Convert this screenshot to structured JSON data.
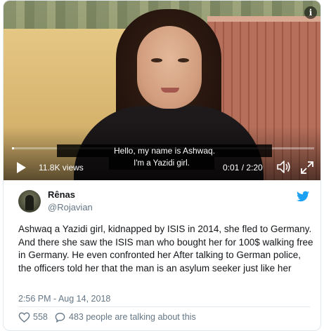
{
  "video": {
    "subtitle_line1": "Hello, my name is Ashwaq.",
    "subtitle_line2": "I'm a Yazidi girl.",
    "views": "11.8K views",
    "time": "0:01 / 2:20",
    "progress": 0.007,
    "icons": {
      "info": "info-icon",
      "play": "play-icon",
      "volume": "volume-icon",
      "fullscreen": "fullscreen-icon"
    }
  },
  "tweet": {
    "display_name": "Rênas",
    "handle": "@Rojavian",
    "text": "Ashwaq a Yazidi girl, kidnapped by ISIS in 2014, she fled to Germany. And there she saw the ISIS man who bought her for 100$ walking free in Germany. He even confronted her After talking to German police, the officers told her that the man is an asylum seeker just like her",
    "timestamp": "2:56 PM - Aug 14, 2018",
    "likes": "558",
    "talking": "483 people are talking about this",
    "colors": {
      "twitter_blue": "#1da1f2",
      "secondary_text": "#657786",
      "primary_text": "#14171a"
    }
  }
}
